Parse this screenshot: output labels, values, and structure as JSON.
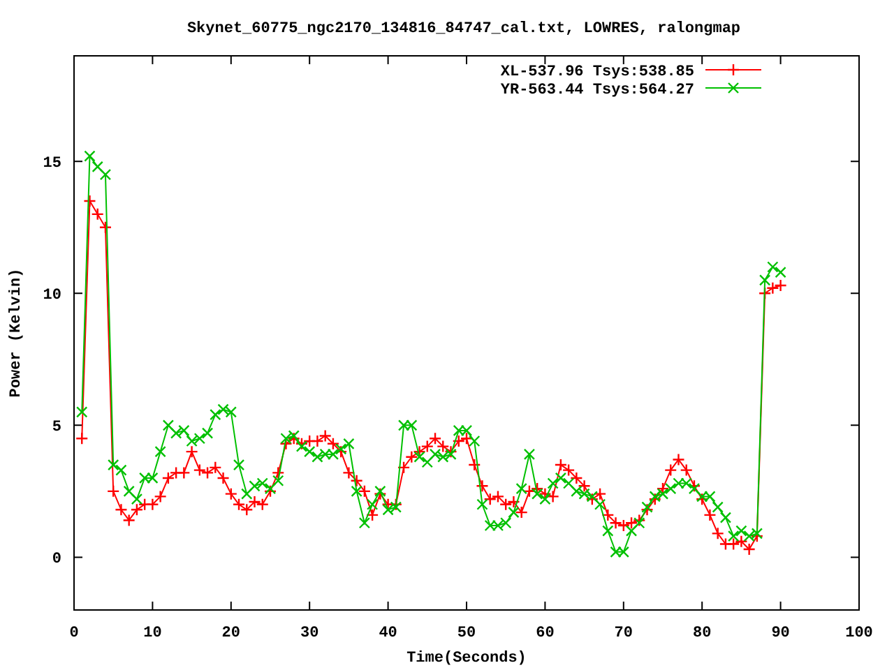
{
  "chart_data": {
    "type": "line",
    "title": "Skynet_60775_ngc2170_134816_84747_cal.txt, LOWRES, ralongmap",
    "xlabel": "Time(Seconds)",
    "ylabel": "Power (Kelvin)",
    "x": [
      1,
      2,
      3,
      4,
      5,
      6,
      7,
      8,
      9,
      10,
      11,
      12,
      13,
      14,
      15,
      16,
      17,
      18,
      19,
      20,
      21,
      22,
      23,
      24,
      25,
      26,
      27,
      28,
      29,
      30,
      31,
      32,
      33,
      34,
      35,
      36,
      37,
      38,
      39,
      40,
      41,
      42,
      43,
      44,
      45,
      46,
      47,
      48,
      49,
      50,
      51,
      52,
      53,
      54,
      55,
      56,
      57,
      58,
      59,
      60,
      61,
      62,
      63,
      64,
      65,
      66,
      67,
      68,
      69,
      70,
      71,
      72,
      73,
      74,
      75,
      76,
      77,
      78,
      79,
      80,
      81,
      82,
      83,
      84,
      85,
      86,
      87,
      88,
      89,
      90
    ],
    "series": [
      {
        "name": "XL-537.96 Tsys:538.85",
        "color": "#ff0000",
        "marker": "plus",
        "values": [
          4.5,
          13.5,
          13,
          12.5,
          2.5,
          1.8,
          1.4,
          1.8,
          2,
          2,
          2.3,
          3,
          3.2,
          3.2,
          4,
          3.3,
          3.2,
          3.4,
          3,
          2.4,
          2,
          1.8,
          2.1,
          2,
          2.5,
          3.2,
          4.3,
          4.5,
          4.3,
          4.4,
          4.4,
          4.6,
          4.3,
          4,
          3.2,
          2.9,
          2.5,
          1.6,
          2.4,
          2,
          2,
          3.4,
          3.8,
          4,
          4.2,
          4.5,
          4.2,
          4,
          4.4,
          4.5,
          3.5,
          2.7,
          2.2,
          2.3,
          2,
          2.1,
          1.7,
          2.5,
          2.6,
          2.4,
          2.3,
          3.5,
          3.3,
          3,
          2.7,
          2.2,
          2.4,
          1.6,
          1.3,
          1.2,
          1.3,
          1.4,
          1.8,
          2.2,
          2.6,
          3.3,
          3.7,
          3.3,
          2.7,
          2.2,
          1.6,
          0.9,
          0.5,
          0.5,
          0.6,
          0.3,
          0.8,
          10,
          10.2,
          10.3
        ]
      },
      {
        "name": "YR-563.44 Tsys:564.27",
        "color": "#00c000",
        "marker": "cross",
        "values": [
          5.5,
          15.2,
          14.8,
          14.5,
          3.5,
          3.3,
          2.5,
          2.2,
          3,
          3,
          4,
          5,
          4.7,
          4.8,
          4.4,
          4.5,
          4.7,
          5.4,
          5.6,
          5.5,
          3.5,
          2.4,
          2.7,
          2.8,
          2.6,
          2.9,
          4.5,
          4.6,
          4.2,
          4,
          3.8,
          3.9,
          3.9,
          4.1,
          4.3,
          2.5,
          1.3,
          2,
          2.5,
          1.8,
          1.9,
          5,
          5,
          3.8,
          3.6,
          3.9,
          3.8,
          3.9,
          4.8,
          4.8,
          4.4,
          2,
          1.2,
          1.2,
          1.3,
          1.7,
          2.6,
          3.9,
          2.4,
          2.2,
          2.8,
          3,
          2.8,
          2.5,
          2.4,
          2.3,
          2,
          1,
          0.2,
          0.2,
          1,
          1.3,
          1.9,
          2.3,
          2.4,
          2.6,
          2.8,
          2.8,
          2.6,
          2.3,
          2.3,
          1.9,
          1.5,
          0.8,
          1,
          0.8,
          0.9,
          10.5,
          11,
          10.8
        ]
      }
    ],
    "legend": true,
    "xlim": [
      0,
      100
    ],
    "ylim": [
      -2,
      19
    ],
    "xticks": [
      0,
      10,
      20,
      30,
      40,
      50,
      60,
      70,
      80,
      90,
      100
    ],
    "yticks": [
      0,
      5,
      10,
      15
    ]
  }
}
